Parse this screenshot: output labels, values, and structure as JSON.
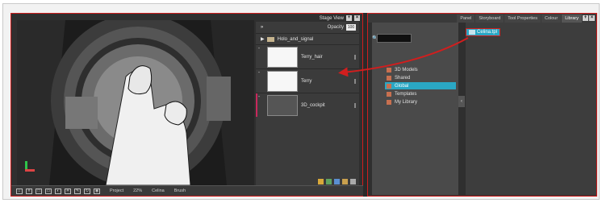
{
  "stage": {
    "title": "Stage View",
    "opacity_label": "Opacity",
    "opacity_value": "100"
  },
  "layers": [
    {
      "type": "folder",
      "name": "Holo_and_signal"
    },
    {
      "type": "layer",
      "name": "Terry_hair"
    },
    {
      "type": "layer",
      "name": "Terry"
    },
    {
      "type": "layer",
      "name": "3D_cockpit"
    }
  ],
  "status_bar": {
    "project": "Project",
    "zoom": "22%",
    "palette": "Celina",
    "tool": "Brush"
  },
  "library": {
    "tabs": [
      "Panel",
      "Storyboard",
      "Tool Properties",
      "Colour",
      "Library"
    ],
    "active_tab": "Library",
    "tree": [
      "3D Models",
      "Shared",
      "Global",
      "Templates",
      "My Library"
    ],
    "selected": "Global",
    "file": "Celina.tpl"
  },
  "colors": {
    "highlight": "#d11e1e",
    "selection": "#2aa7c4"
  }
}
